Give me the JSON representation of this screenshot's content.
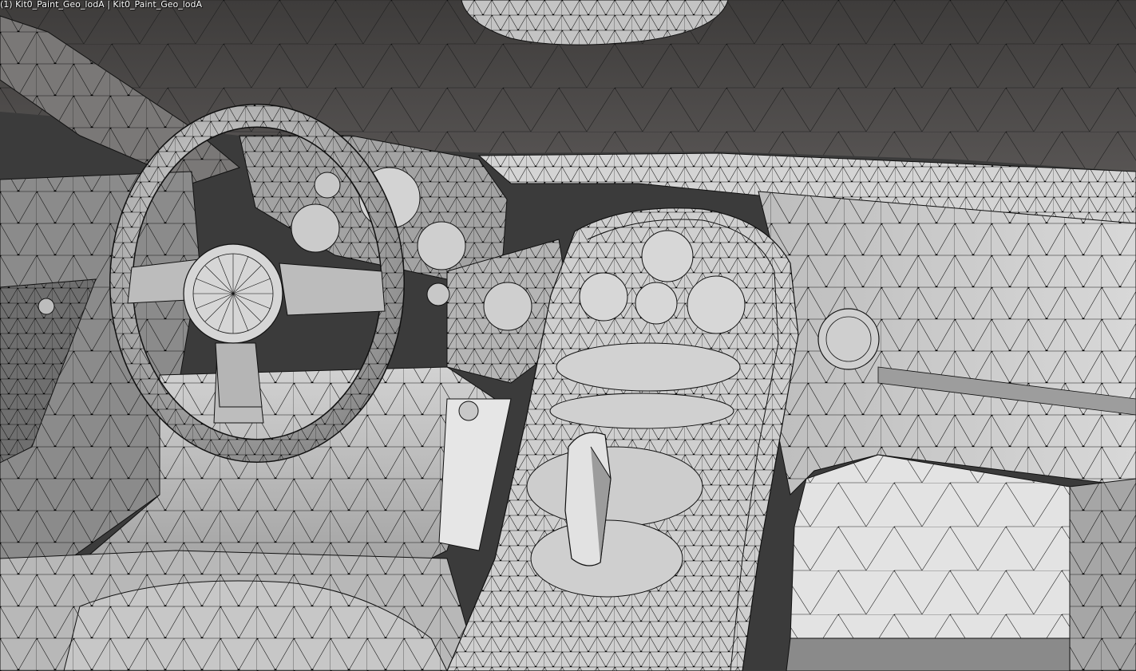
{
  "viewport": {
    "object_label": "(1) Kit0_Paint_Geo_lodA | Kit0_Paint_Geo_lodA",
    "mode": "edit-wireframe",
    "colors": {
      "background": "#3b3b3b",
      "ceiling": "#4a4847",
      "surface_light": "#c9c9c9",
      "surface_mid": "#a9a9a9",
      "surface_dark": "#6f6f6f",
      "wire": "#111111",
      "vertex": "#000000",
      "label": "#ffffff"
    }
  }
}
